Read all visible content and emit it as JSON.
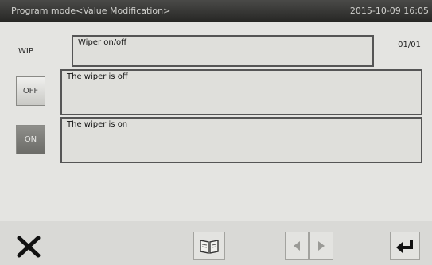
{
  "header": {
    "title": "Program mode<Value Modification>",
    "datetime": "2015-10-09 16:05"
  },
  "parameter": {
    "code": "WIP",
    "name": "Wiper on/off",
    "page": "01/01"
  },
  "options": [
    {
      "button_label": "OFF",
      "description": "The wiper is off",
      "selected": false
    },
    {
      "button_label": "ON",
      "description": "The wiper is on",
      "selected": true
    }
  ],
  "toolbar": {
    "icons": [
      "close-icon",
      "book-icon",
      "triangle-left-icon",
      "triangle-right-icon",
      "enter-icon"
    ]
  }
}
